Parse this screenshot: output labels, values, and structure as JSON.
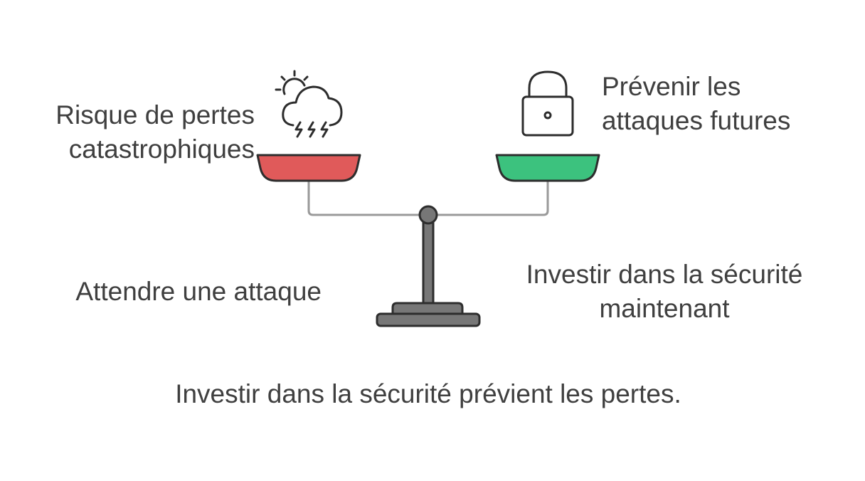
{
  "options": {
    "left": {
      "top_label": [
        "Risque de pertes",
        "catastrophiques"
      ],
      "bottom_label": "Attendre une attaque",
      "icon": "storm-cloud-icon",
      "pan_color": "#e05a5a"
    },
    "right": {
      "top_label": [
        "Prévenir les",
        "attaques futures"
      ],
      "bottom_label": [
        "Investir dans la sécurité",
        "maintenant"
      ],
      "icon": "padlock-icon",
      "pan_color": "#3cc27e"
    }
  },
  "conclusion": "Investir dans la sécurité prévient les pertes.",
  "colors": {
    "text": "#3f3f3f",
    "outline": "#2d2d2d",
    "beam": "#9a9a9a",
    "stand": "#777777"
  }
}
